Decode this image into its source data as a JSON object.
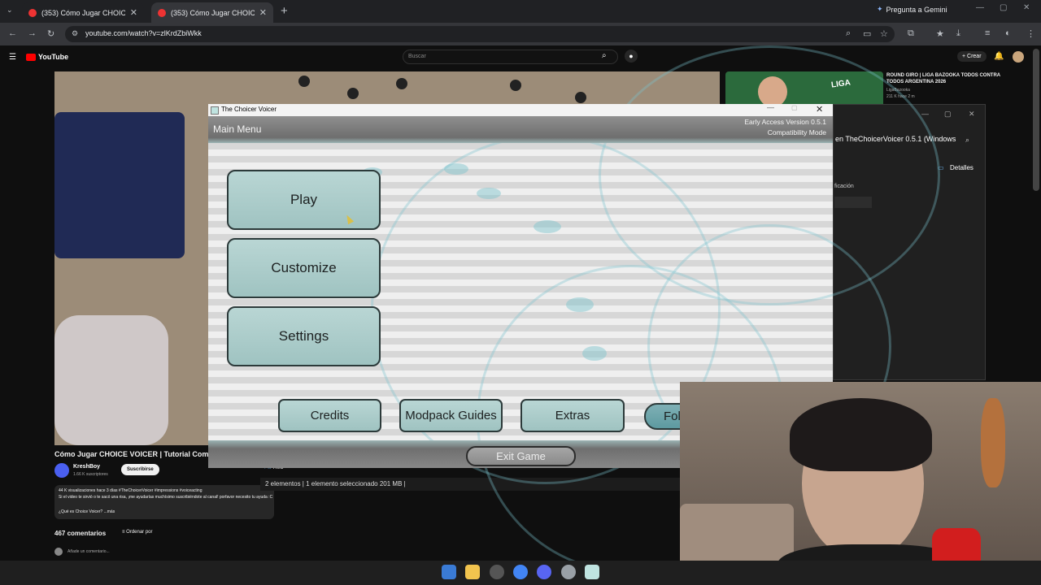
{
  "browser": {
    "tabs": [
      {
        "title": "(353) Cómo Jugar CHOICE VOI",
        "close": "✕"
      },
      {
        "title": "(353) Cómo Jugar CHOICE VOI",
        "close": "✕"
      }
    ],
    "new_tab": "+",
    "gemini_label": "Pregunta a Gemini",
    "url": "youtube.com/watch?v=zlKrdZbiWkk"
  },
  "youtube": {
    "logo": "YouTube",
    "search_placeholder": "Buscar",
    "crear_label": "+ Crear",
    "video_title": "Cómo Jugar CHOICE VOICER | Tutorial Complet",
    "channel_name": "KreshBoy",
    "channel_subs": "1.66 K suscriptores",
    "subscribe_label": "Suscribirse",
    "desc_stats": "44 K visualizaciones  hace 3 días  #TheChoicerVoicer #impressions #voiceacting",
    "desc_text": "Si el video te sirvió o te sacó una risa, ¡me ayudarías muchísimo suscribiéndote al canal! porfavor necesito tu ayuda :C",
    "desc_more": "¿Qué es Choice Voicer?  ...más",
    "comments_count": "467 comentarios",
    "sort_label": "Ordenar por",
    "add_comment": "Añade un comentario...",
    "rec_title": "ROUND GIRO | LIGA BAZOOKA TODOS CONTRA TODOS ARGENTINA 2026",
    "rec_channel": "LigaBazooka",
    "rec_meta": "211 K  hace 2 m"
  },
  "explorer": {
    "search_text": "en TheChoicerVoicer 0.5.1 (Windows",
    "details_label": "Detalles",
    "fragment": "ficación",
    "red_label": "Red",
    "status": "2 elementos  |  1 elemento seleccionado  201 MB  |"
  },
  "game": {
    "window_title": "The Choicer Voicer",
    "header_title": "Main Menu",
    "version_line1": "Early Access Version 0.5.1",
    "version_line2": "Compatibility Mode",
    "buttons": {
      "play": "Play",
      "customize": "Customize",
      "settings": "Settings",
      "credits": "Credits",
      "modpack": "Modpack Guides",
      "extras": "Extras",
      "folder": "Fold",
      "exit": "Exit Game"
    }
  },
  "colors": {
    "button_teal": "#a9cbc9",
    "accent_teal": "#7ac4cd",
    "youtube_red": "#ff0000"
  }
}
